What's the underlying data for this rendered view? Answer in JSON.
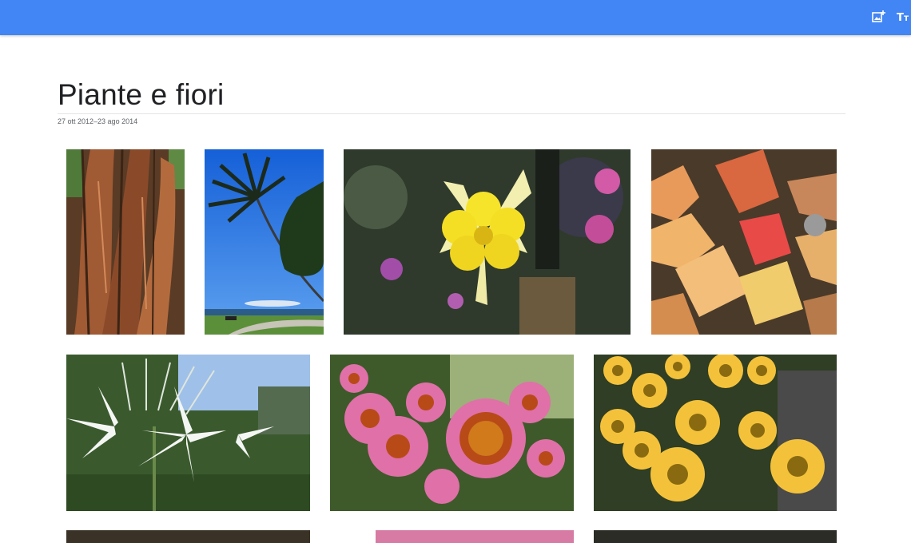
{
  "header": {
    "color": "#4285f4",
    "icons": [
      "add-photo-icon",
      "text-size-icon"
    ]
  },
  "album": {
    "title": "Piante e fiori",
    "date_range": "27 ott 2012–23 ago 2014"
  },
  "photos": [
    {
      "subject": "tree-trunk-photo"
    },
    {
      "subject": "palm-tree-photo"
    },
    {
      "subject": "yellow-columbine-photo"
    },
    {
      "subject": "autumn-leaves-photo"
    },
    {
      "subject": "white-agapanthus-photo"
    },
    {
      "subject": "pink-echinacea-photo"
    },
    {
      "subject": "yellow-echinacea-photo"
    }
  ]
}
